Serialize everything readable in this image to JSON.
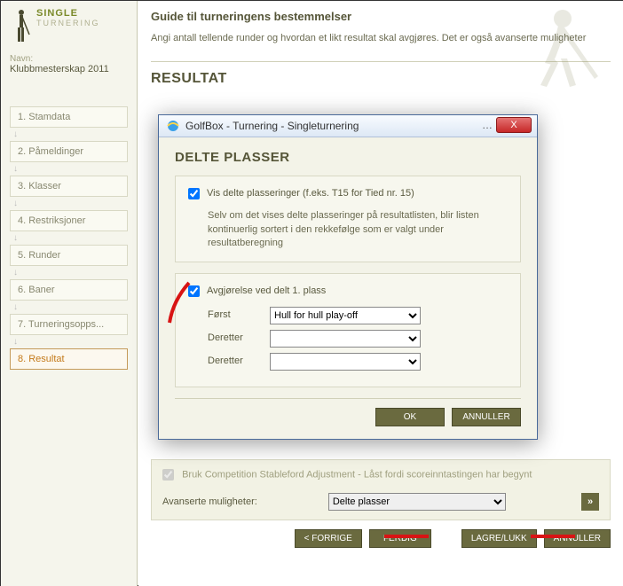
{
  "logo": {
    "a": "SINGLE",
    "b": "TURNERING"
  },
  "navn_label": "Navn:",
  "navn_value": "Klubbmesterskap 2011",
  "steps": [
    {
      "label": "1. Stamdata"
    },
    {
      "label": "2. Påmeldinger"
    },
    {
      "label": "3. Klasser"
    },
    {
      "label": "4. Restriksjoner"
    },
    {
      "label": "5. Runder"
    },
    {
      "label": "6. Baner"
    },
    {
      "label": "7. Turneringsopps..."
    },
    {
      "label": "8. Resultat"
    }
  ],
  "guide": {
    "title": "Guide til turneringens bestemmelser",
    "sub": "Angi antall tellende runder og hvordan et likt resultat skal avgjøres. Det er også avanserte muligheter"
  },
  "result_heading": "RESULTAT",
  "locked": {
    "label": "Bruk Competition Stableford Adjustment",
    "suffix": " - Låst fordi scoreinntastingen har begynt"
  },
  "adv": {
    "label": "Avanserte muligheter:",
    "selected": "Delte plasser",
    "go": "»"
  },
  "footer": {
    "prev": "< FORRIGE",
    "done": "FERDIG",
    "save": "LAGRE/LUKK",
    "cancel": "ANNULLER"
  },
  "dialog": {
    "title": "GolfBox - Turnering  - Singleturnering",
    "winmin": "…",
    "close": "X",
    "heading": "DELTE PLASSER",
    "box1": {
      "chk": "Vis delte plasseringer (f.eks. T15 for Tied nr. 15)",
      "note": "Selv om det vises delte plasseringer på resultatlisten, blir listen kontinuerlig sortert i den rekkefølge som er valgt under resultatberegning"
    },
    "box2": {
      "chk": "Avgjørelse ved delt 1. plass",
      "first_label": "Først",
      "first_value": "Hull for hull play-off",
      "then_label": "Deretter",
      "then1_value": "",
      "then2_value": ""
    },
    "ok": "OK",
    "cancel": "ANNULLER"
  }
}
